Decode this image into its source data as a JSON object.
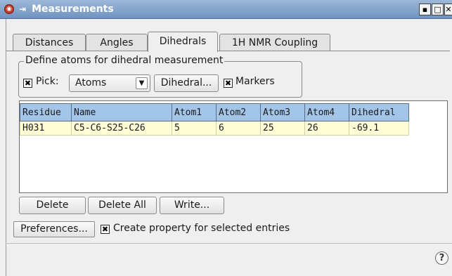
{
  "window": {
    "title": "Measurements",
    "app_icon": "app-logo-icon",
    "pin_icon": "pin-icon"
  },
  "window_controls": {
    "minimize": "▪",
    "maximize": "□",
    "close": "✕"
  },
  "tabs": [
    {
      "label": "Distances",
      "active": false
    },
    {
      "label": "Angles",
      "active": false
    },
    {
      "label": "Dihedrals",
      "active": true
    },
    {
      "label": "1H NMR Coupling",
      "active": false
    }
  ],
  "group": {
    "legend": "Define atoms for dihedral measurement",
    "pick_checked": true,
    "pick_label": "Pick:",
    "pick_value": "Atoms",
    "dihedral_button": "Dihedral...",
    "markers_checked": true,
    "markers_label": "Markers"
  },
  "table": {
    "columns": [
      "Residue",
      "Name",
      "Atom1",
      "Atom2",
      "Atom3",
      "Atom4",
      "Dihedral"
    ],
    "rows": [
      [
        "H031",
        "C5-C6-S25-C26",
        "5",
        "6",
        "25",
        "26",
        "-69.1"
      ]
    ],
    "header_color": "#a3c5e9",
    "row_color": "#fefdd6"
  },
  "buttons": {
    "delete": "Delete",
    "delete_all": "Delete All",
    "write": "Write..."
  },
  "footer": {
    "preferences_button": "Preferences...",
    "create_property_checked": true,
    "create_property_label": "Create property for selected entries"
  },
  "help": {
    "icon": "?"
  }
}
